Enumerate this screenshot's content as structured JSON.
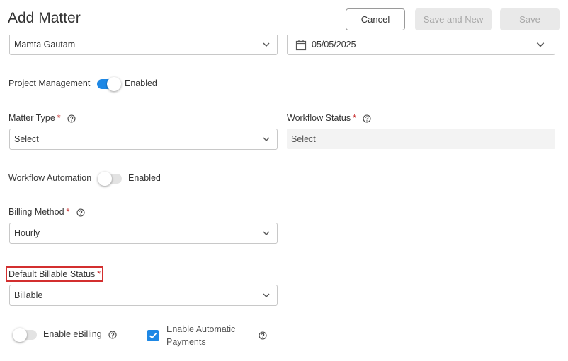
{
  "header": {
    "title": "Add Matter",
    "cancel_label": "Cancel",
    "save_new_label": "Save and New",
    "save_label": "Save"
  },
  "top_row": {
    "user_value": "Mamta Gautam",
    "date_value": "05/05/2025"
  },
  "project_management": {
    "label": "Project Management",
    "state_label": "Enabled",
    "enabled": true
  },
  "matter_type": {
    "label": "Matter Type",
    "value": "Select"
  },
  "workflow_status": {
    "label": "Workflow Status",
    "value": "Select"
  },
  "workflow_automation": {
    "label": "Workflow Automation",
    "state_label": "Enabled",
    "enabled": false
  },
  "billing_method": {
    "label": "Billing Method",
    "value": "Hourly"
  },
  "default_billable_status": {
    "label": "Default Billable Status",
    "value": "Billable"
  },
  "ebilling": {
    "label": "Enable eBilling",
    "enabled": false
  },
  "automatic_payments": {
    "label_line1": "Enable Automatic",
    "label_line2": "Payments",
    "checked": true
  },
  "required_marker": "*",
  "colors": {
    "accent": "#1e88e5",
    "required": "#c62828",
    "highlight_border": "#d32f2f"
  }
}
